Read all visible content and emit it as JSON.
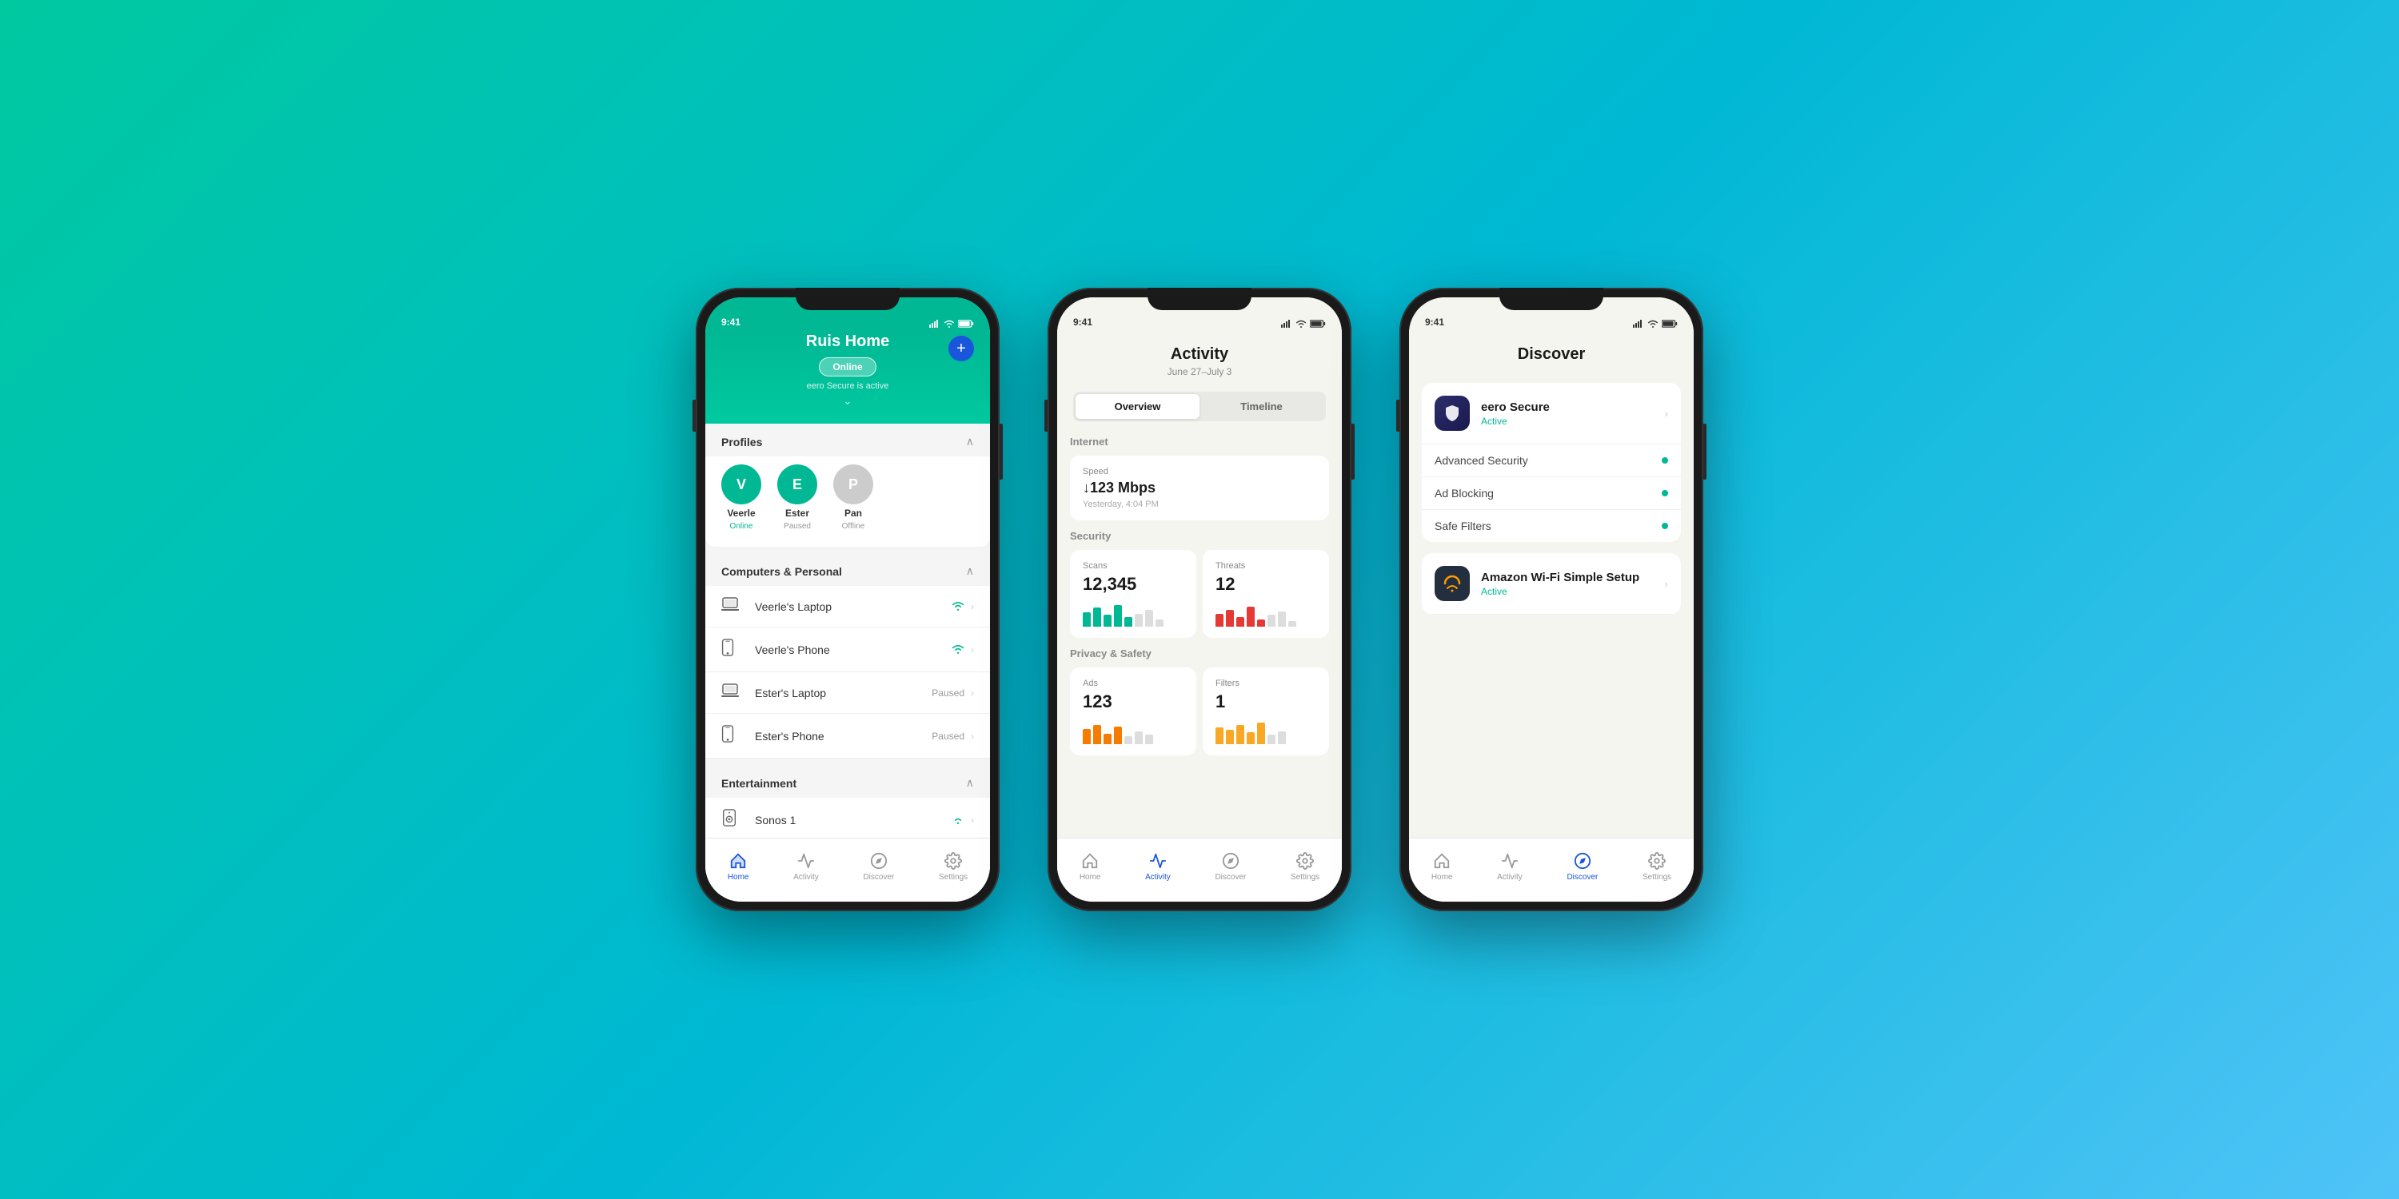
{
  "background": {
    "gradient_start": "#00c9a0",
    "gradient_end": "#4fc3f7"
  },
  "phone1": {
    "status_bar": {
      "time": "9:41",
      "bg": "#00b894"
    },
    "header": {
      "title": "Ruis Home",
      "add_btn": "+",
      "online_badge": "Online",
      "secure_text": "eero Secure is active"
    },
    "profiles": {
      "section_title": "Profiles",
      "items": [
        {
          "initial": "V",
          "name": "Veerle",
          "status": "Online",
          "status_type": "online",
          "color": "#00b894"
        },
        {
          "initial": "E",
          "name": "Ester",
          "status": "Paused",
          "status_type": "paused",
          "color": "#00b894"
        },
        {
          "initial": "P",
          "name": "Pan",
          "status": "Offline",
          "status_type": "offline",
          "color": "#ccc"
        }
      ]
    },
    "computers_section": {
      "title": "Computers & Personal",
      "devices": [
        {
          "name": "Veerle's Laptop",
          "icon": "laptop",
          "status": "wifi",
          "paused": false
        },
        {
          "name": "Veerle's Phone",
          "icon": "phone",
          "status": "wifi",
          "paused": false
        },
        {
          "name": "Ester's Laptop",
          "icon": "laptop",
          "status": "Paused",
          "paused": true
        },
        {
          "name": "Ester's Phone",
          "icon": "phone",
          "status": "Paused",
          "paused": true
        }
      ]
    },
    "entertainment_section": {
      "title": "Entertainment",
      "devices": [
        {
          "name": "Sonos 1",
          "icon": "speaker",
          "status": "wifi",
          "paused": false
        }
      ]
    },
    "nav": {
      "items": [
        {
          "label": "Home",
          "active": true
        },
        {
          "label": "Activity",
          "active": false
        },
        {
          "label": "Discover",
          "active": false
        },
        {
          "label": "Settings",
          "active": false
        }
      ]
    }
  },
  "phone2": {
    "status_bar": {
      "time": "9:41"
    },
    "header": {
      "title": "Activity",
      "date_range": "June 27–July 3"
    },
    "tabs": [
      {
        "label": "Overview",
        "active": true
      },
      {
        "label": "Timeline",
        "active": false
      }
    ],
    "internet": {
      "section_title": "Internet",
      "speed": {
        "label": "Speed",
        "value": "↓123 Mbps",
        "sub": "Yesterday, 4:04 PM"
      }
    },
    "security": {
      "section_title": "Security",
      "scans": {
        "label": "Scans",
        "value": "12,345",
        "bars": [
          {
            "h": 60,
            "color": "#00b894"
          },
          {
            "h": 80,
            "color": "#00b894"
          },
          {
            "h": 50,
            "color": "#00b894"
          },
          {
            "h": 90,
            "color": "#00b894"
          },
          {
            "h": 40,
            "color": "#00b894"
          },
          {
            "h": 55,
            "color": "#ccc"
          },
          {
            "h": 70,
            "color": "#ccc"
          },
          {
            "h": 30,
            "color": "#ccc"
          }
        ]
      },
      "threats": {
        "label": "Threats",
        "value": "12",
        "bars": [
          {
            "h": 55,
            "color": "#e53935"
          },
          {
            "h": 70,
            "color": "#e53935"
          },
          {
            "h": 40,
            "color": "#e53935"
          },
          {
            "h": 85,
            "color": "#e53935"
          },
          {
            "h": 30,
            "color": "#e53935"
          },
          {
            "h": 50,
            "color": "#ccc"
          },
          {
            "h": 65,
            "color": "#ccc"
          },
          {
            "h": 25,
            "color": "#ccc"
          }
        ]
      }
    },
    "privacy": {
      "section_title": "Privacy & Safety",
      "ads": {
        "label": "Ads",
        "value": "123",
        "bars": [
          {
            "h": 65,
            "color": "#f57c00"
          },
          {
            "h": 80,
            "color": "#f57c00"
          },
          {
            "h": 45,
            "color": "#f57c00"
          },
          {
            "h": 75,
            "color": "#f57c00"
          },
          {
            "h": 35,
            "color": "#ccc"
          },
          {
            "h": 55,
            "color": "#ccc"
          },
          {
            "h": 40,
            "color": "#ccc"
          }
        ]
      },
      "filters": {
        "label": "Filters",
        "value": "1",
        "bars": [
          {
            "h": 70,
            "color": "#f9a825"
          },
          {
            "h": 60,
            "color": "#f9a825"
          },
          {
            "h": 80,
            "color": "#f9a825"
          },
          {
            "h": 50,
            "color": "#f9a825"
          },
          {
            "h": 90,
            "color": "#f9a825"
          },
          {
            "h": 40,
            "color": "#ccc"
          },
          {
            "h": 55,
            "color": "#ccc"
          }
        ]
      }
    },
    "nav": {
      "items": [
        {
          "label": "Home",
          "active": false
        },
        {
          "label": "Activity",
          "active": true
        },
        {
          "label": "Discover",
          "active": false
        },
        {
          "label": "Settings",
          "active": false
        }
      ]
    }
  },
  "phone3": {
    "status_bar": {
      "time": "9:41"
    },
    "header": {
      "title": "Discover"
    },
    "eero_secure": {
      "name": "eero Secure",
      "status": "Active",
      "features": [
        {
          "label": "Advanced Security",
          "enabled": true
        },
        {
          "label": "Ad Blocking",
          "enabled": true
        },
        {
          "label": "Safe Filters",
          "enabled": true
        }
      ]
    },
    "amazon_wifi": {
      "name": "Amazon Wi-Fi Simple Setup",
      "status": "Active"
    },
    "nav": {
      "items": [
        {
          "label": "Home",
          "active": false
        },
        {
          "label": "Activity",
          "active": false
        },
        {
          "label": "Discover",
          "active": true
        },
        {
          "label": "Settings",
          "active": false
        }
      ]
    }
  }
}
